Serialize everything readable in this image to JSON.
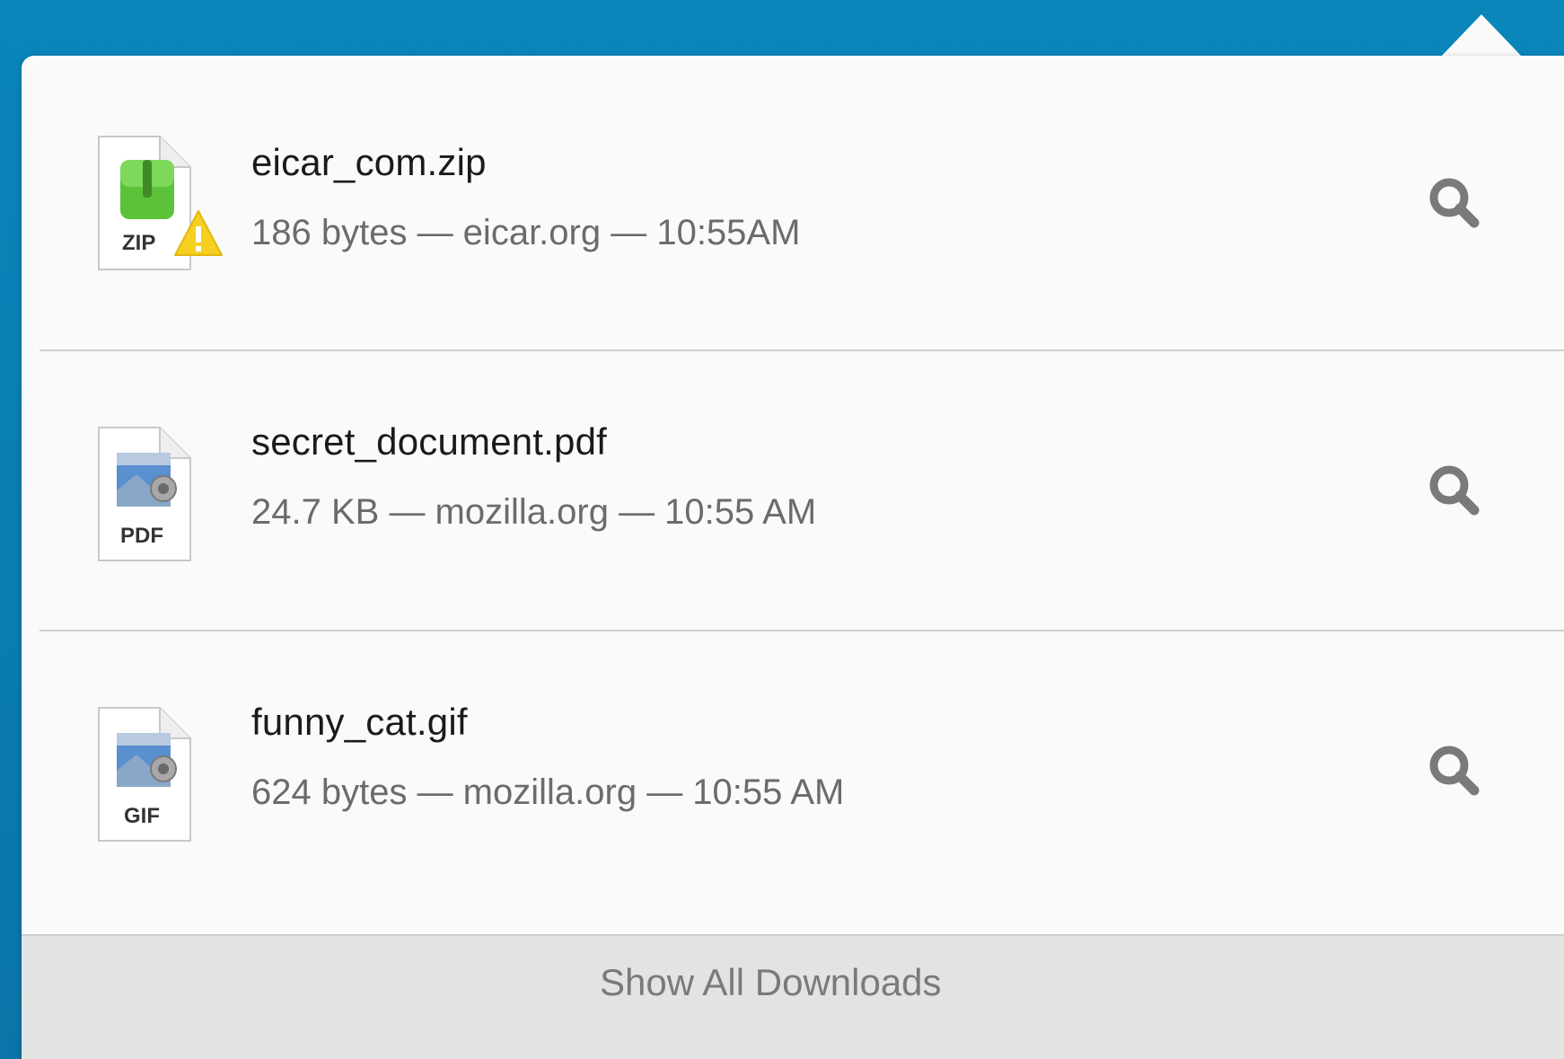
{
  "downloads": [
    {
      "name": "eicar_com.zip",
      "meta": "186 bytes — eicar.org — 10:55AM",
      "type_label": "ZIP",
      "icon": "zip-file-icon",
      "warning_icon": "warning-triangle-icon"
    },
    {
      "name": "secret_document.pdf",
      "meta": "24.7 KB — mozilla.org — 10:55 AM",
      "type_label": "PDF",
      "icon": "pdf-file-icon"
    },
    {
      "name": "funny_cat.gif",
      "meta": "624 bytes — mozilla.org — 10:55 AM",
      "type_label": "GIF",
      "icon": "gif-file-icon"
    }
  ],
  "footer": {
    "show_all_label": "Show All Downloads"
  },
  "colors": {
    "background": "#0a80b5",
    "panel": "#fafafa",
    "footer": "#e3e3e3",
    "zip_green": "#5cc23a",
    "warning_yellow": "#f5d020"
  }
}
